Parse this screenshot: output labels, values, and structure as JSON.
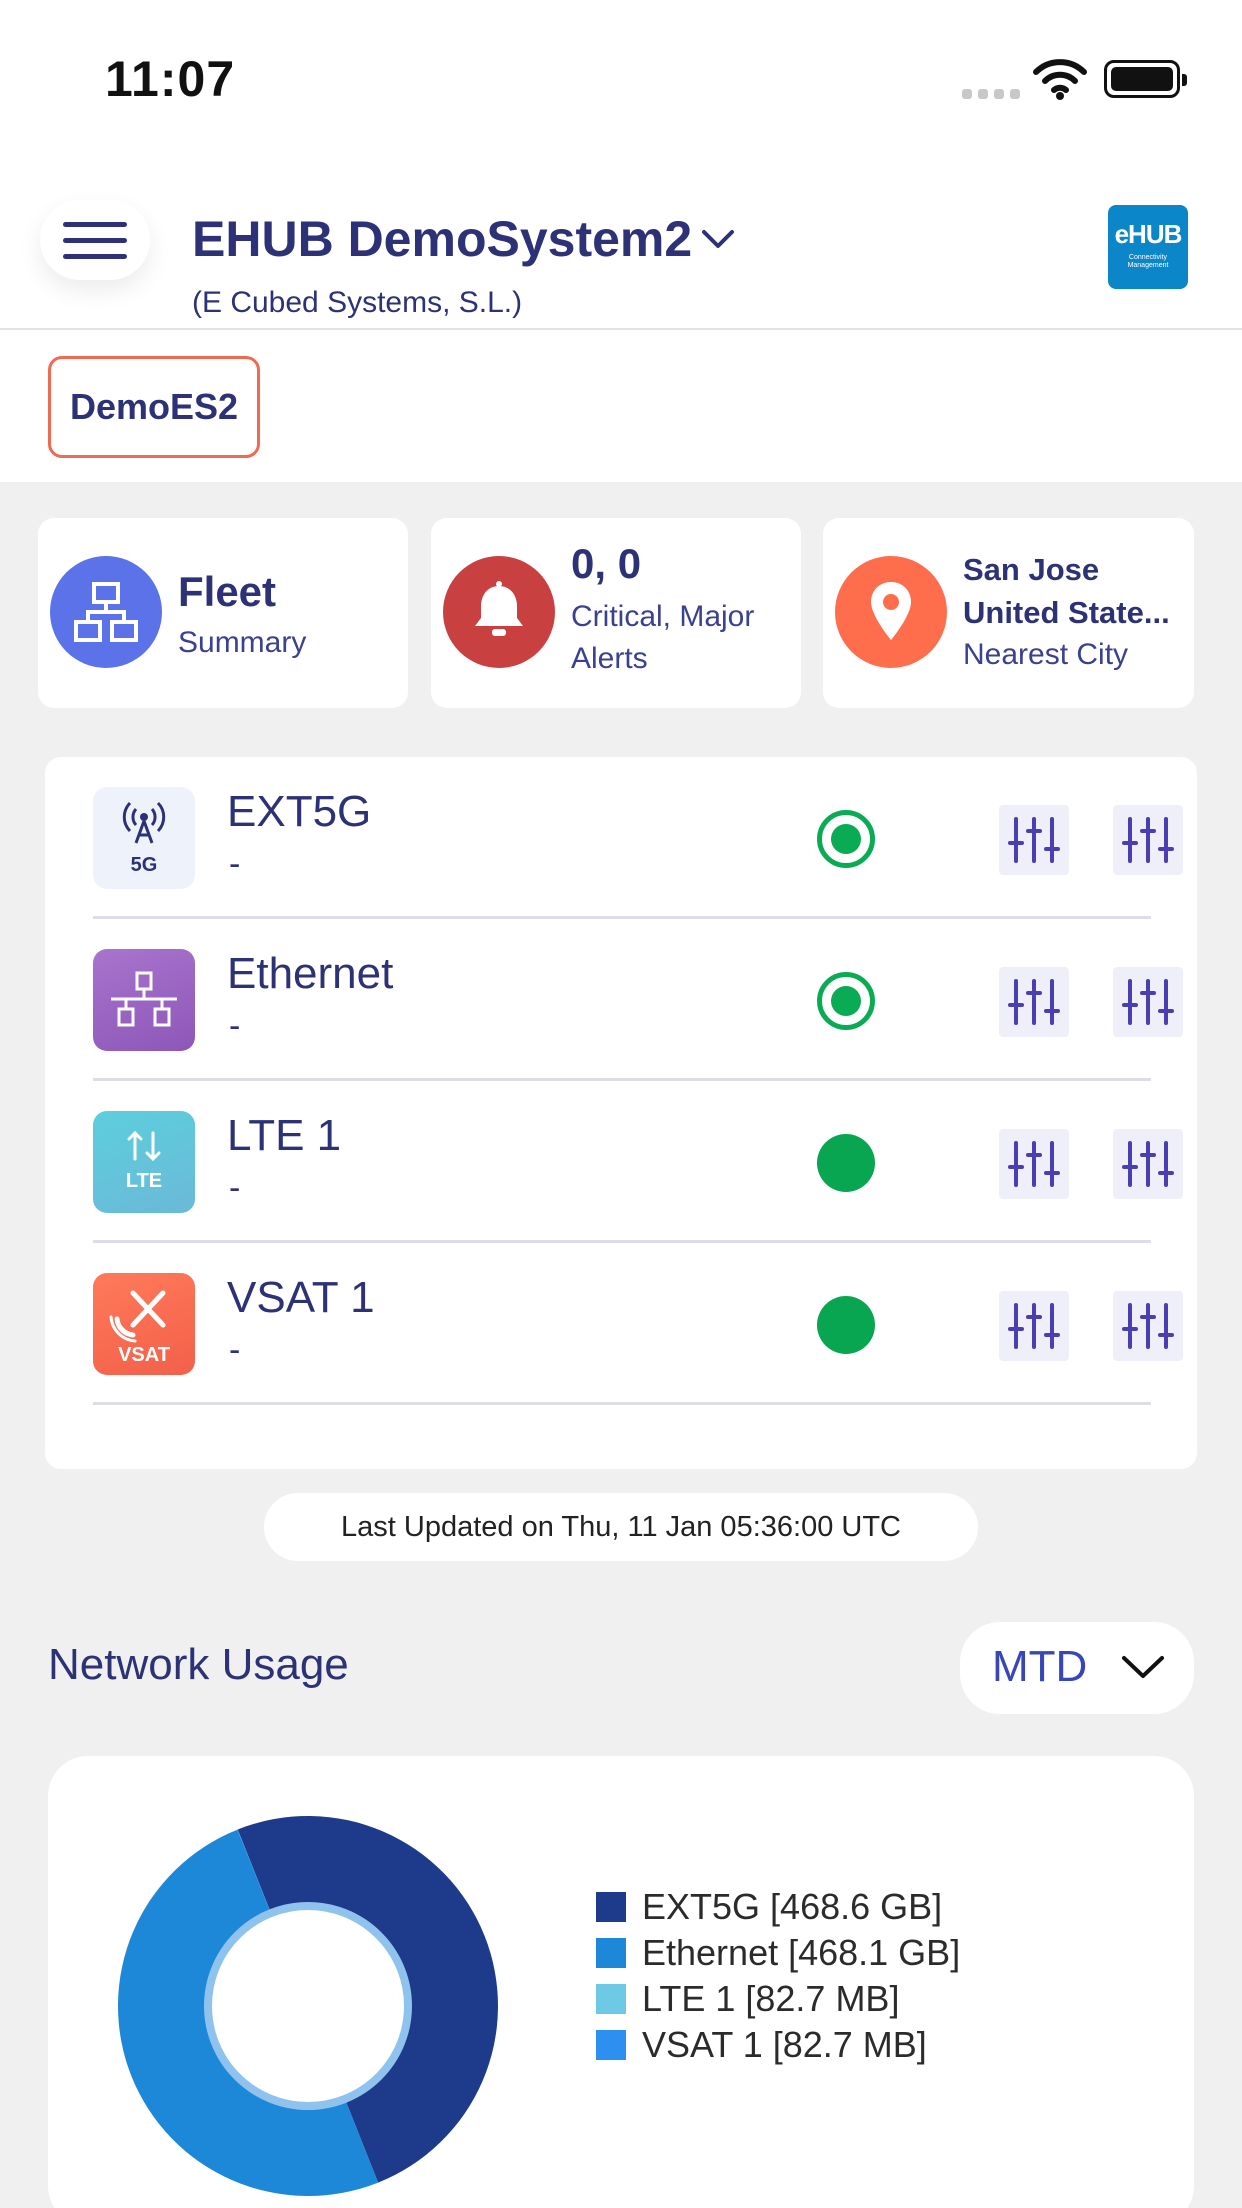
{
  "status_bar": {
    "time": "11:07"
  },
  "header": {
    "system_name": "EHUB DemoSystem2",
    "organization": "(E Cubed Systems, S.L.)",
    "logo_text": "eHUB",
    "logo_subtext": "Connectivity Management"
  },
  "site_tab": {
    "label": "DemoES2"
  },
  "summary_cards": {
    "fleet": {
      "title": "Fleet",
      "subtitle": "Summary",
      "color": "#5b72e8"
    },
    "alerts": {
      "value": "0, 0",
      "label_line1": "Critical, Major",
      "label_line2": "Alerts",
      "color": "#c94040"
    },
    "location": {
      "city": "San Jose",
      "country": "United State...",
      "label": "Nearest City",
      "color": "#ff6e4c"
    }
  },
  "interfaces": [
    {
      "name": "EXT5G",
      "value": "-",
      "icon": "antenna-5g-icon",
      "status": "ring"
    },
    {
      "name": "Ethernet",
      "value": "-",
      "icon": "ethernet-network-icon",
      "status": "ring"
    },
    {
      "name": "LTE 1",
      "value": "-",
      "icon": "lte-icon",
      "status": "dot"
    },
    {
      "name": "VSAT 1",
      "value": "-",
      "icon": "vsat-satellite-icon",
      "status": "dot"
    }
  ],
  "last_updated": "Last Updated on Thu, 11 Jan 05:36:00  UTC",
  "network_usage": {
    "title": "Network Usage",
    "period": "MTD"
  },
  "chart_data": {
    "type": "pie",
    "categories": [
      "EXT5G",
      "Ethernet",
      "LTE 1",
      "VSAT 1"
    ],
    "values": [
      468.6,
      468.1,
      0.0827,
      0.0827
    ],
    "units": [
      "GB",
      "GB",
      "MB",
      "MB"
    ],
    "legend_labels": [
      "EXT5G [468.6 GB]",
      "Ethernet [468.1 GB]",
      "LTE 1 [82.7 MB]",
      "VSAT 1 [82.7 MB]"
    ],
    "colors": [
      "#1e3a8a",
      "#1d88d8",
      "#6ec9e4",
      "#2d8ff0"
    ],
    "legend_position": "right",
    "donut": true
  }
}
